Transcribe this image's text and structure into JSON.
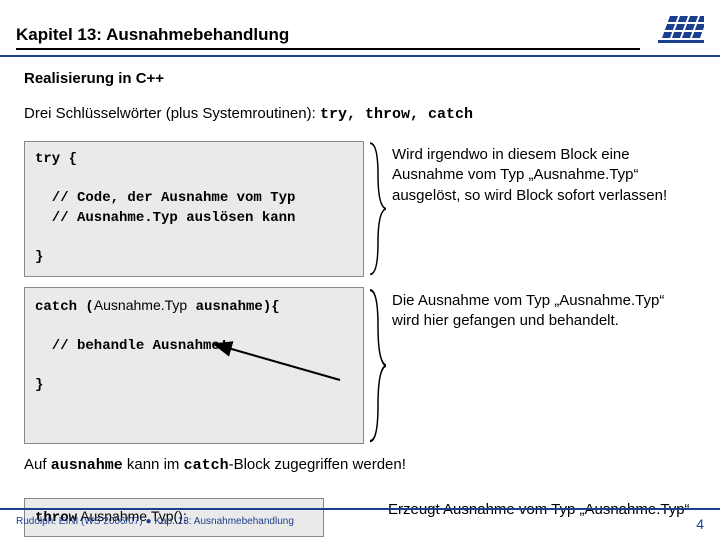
{
  "header": {
    "title": "Kapitel 13: Ausnahmebehandlung"
  },
  "body": {
    "subtitle": "Realisierung in C++",
    "intro_prefix": "Drei Schlüsselwörter (plus Systemroutinen):  ",
    "intro_code": "try, throw, catch",
    "try_block": {
      "code": "try {\n\n  // Code, der Ausnahme vom Typ\n  // Ausnahme.Typ auslösen kann\n\n}",
      "explain": "Wird irgendwo in diesem Block eine Ausnahme vom Typ „Ausnahme.Typ“ ausgelöst,\nso wird Block sofort verlassen!"
    },
    "catch_block": {
      "code_pre": "catch (",
      "code_type": "Ausnahme.Typ",
      "code_post": " ausnahme){\n\n  // behandle Ausnahme!\n\n}",
      "explain": "Die Ausnahme vom Typ „Ausnahme.Typ“ wird hier gefangen und behandelt."
    },
    "sentence_parts": {
      "p1": "Auf ",
      "c1": "ausnahme",
      "p2": " kann im ",
      "c2": "catch",
      "p3": "-Block zugegriffen werden!"
    },
    "throw_block": {
      "code_kw": "throw",
      "code_call": " Ausnahme.Typ();",
      "explain": "Erzeugt Ausnahme vom Typ „Ausnahme.Typ“"
    }
  },
  "footer": {
    "left": "Rudolph: EINI (WS 2006/07)  ●  Kap. 13: Ausnahmebehandlung",
    "page": "4"
  }
}
